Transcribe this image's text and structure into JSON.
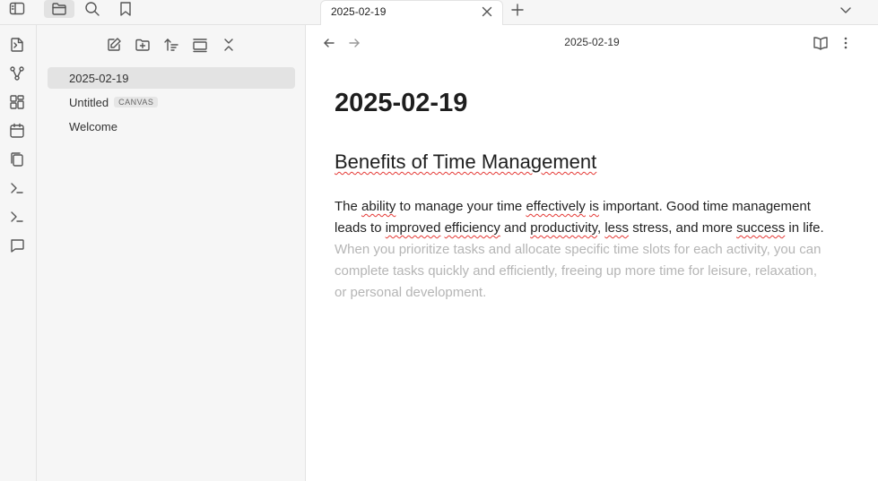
{
  "tab": {
    "title": "2025-02-19"
  },
  "view": {
    "title": "2025-02-19"
  },
  "explorer": {
    "files": [
      {
        "name": "2025-02-19",
        "tag": "",
        "active": true
      },
      {
        "name": "Untitled",
        "tag": "CANVAS",
        "active": false
      },
      {
        "name": "Welcome",
        "tag": "",
        "active": false
      }
    ]
  },
  "document": {
    "heading1": "2025-02-19",
    "heading2": "Benefits of Time Management",
    "paragraph": {
      "segments": [
        {
          "text": "The ",
          "spell": false
        },
        {
          "text": "ability",
          "spell": true
        },
        {
          "text": " to manage your time ",
          "spell": false
        },
        {
          "text": "effectively",
          "spell": true
        },
        {
          "text": " ",
          "spell": false
        },
        {
          "text": "is",
          "spell": true
        },
        {
          "text": " important. Good time management leads to ",
          "spell": false
        },
        {
          "text": "improved",
          "spell": true
        },
        {
          "text": " ",
          "spell": false
        },
        {
          "text": "efficiency",
          "spell": true
        },
        {
          "text": " and ",
          "spell": false
        },
        {
          "text": "productivity",
          "spell": true
        },
        {
          "text": ", ",
          "spell": false
        },
        {
          "text": "less",
          "spell": true
        },
        {
          "text": " stress, and more ",
          "spell": false
        },
        {
          "text": "success",
          "spell": true
        },
        {
          "text": " in life. ",
          "spell": false
        }
      ],
      "ghost_text": "When you prioritize tasks and allocate specific time slots for each activity, you can complete tasks quickly and efficiently, freeing up more time for leisure, relaxation, or personal development."
    }
  },
  "icons": {
    "topbar": [
      "sidebar-toggle-icon",
      "files-icon",
      "search-icon",
      "bookmark-icon"
    ],
    "ribbon": [
      "open-quick-switcher-icon",
      "graph-view-icon",
      "canvas-icon",
      "daily-note-icon",
      "templates-icon",
      "command-palette-icon",
      "terminal-icon",
      "comment-icon"
    ],
    "explorer_toolbar": [
      "new-note-icon",
      "new-folder-icon",
      "sort-icon",
      "auto-reveal-icon",
      "collapse-all-icon"
    ]
  }
}
